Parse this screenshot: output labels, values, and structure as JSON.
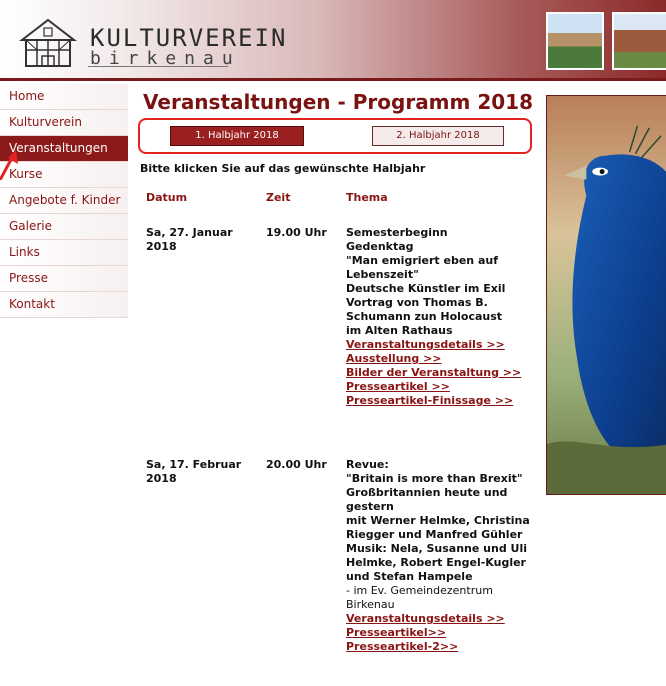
{
  "header": {
    "logo_title": "KULTURVEREIN",
    "logo_sub": "birkenau"
  },
  "sidebar": {
    "items": [
      {
        "label": "Home"
      },
      {
        "label": "Kulturverein"
      },
      {
        "label": "Veranstaltungen"
      },
      {
        "label": "Kurse"
      },
      {
        "label": "Angebote f. Kinder"
      },
      {
        "label": "Galerie"
      },
      {
        "label": "Links"
      },
      {
        "label": "Presse"
      },
      {
        "label": "Kontakt"
      }
    ],
    "active_index": 2
  },
  "main": {
    "title": "Veranstaltungen - Programm 2018",
    "tabs": [
      {
        "label": "1. Halbjahr 2018"
      },
      {
        "label": "2. Halbjahr 2018"
      }
    ],
    "hint": "Bitte klicken Sie auf das gewünschte Halbjahr",
    "columns": {
      "date": "Datum",
      "time": "Zeit",
      "topic": "Thema"
    },
    "events": [
      {
        "date_line1": "Sa, 27. Januar",
        "date_line2": "2018",
        "time": "19.00 Uhr",
        "topic_lines": [
          "Semesterbeginn",
          "Gedenktag",
          "\"Man emigriert eben auf",
          "Lebenszeit\"",
          "Deutsche Künstler im Exil",
          "Vortrag von Thomas B.",
          "Schumann zun Holocaust",
          "im Alten Rathaus"
        ],
        "links": [
          "Veranstaltungsdetails >>",
          "Ausstellung >>",
          "Bilder der Veranstaltung >>",
          "Presseartikel >>",
          "Presseartikel-Finissage >>"
        ]
      },
      {
        "date_line1": "Sa, 17. Februar",
        "date_line2": "2018",
        "time": "20.00 Uhr",
        "topic_lines": [
          "Revue:",
          "\"Britain is more than Brexit\"",
          "Großbritannien heute und",
          "gestern",
          "mit Werner Helmke, Christina",
          "Riegger und Manfred Gühler",
          "Musik: Nela, Susanne und Uli",
          "Helmke, Robert Engel-Kugler",
          "und Stefan Hampele"
        ],
        "plain_lines": [
          "- im Ev. Gemeindezentrum",
          "Birkenau"
        ],
        "links": [
          "Veranstaltungsdetails >>",
          "Presseartikel>>",
          "Presseartikel-2>>"
        ]
      }
    ]
  },
  "colors": {
    "brand_red": "#8c1a1a",
    "link_red": "#8a1414",
    "highlight_box": "#e52222"
  },
  "icons": {
    "logo": "half-timbered-house-icon",
    "annotation": "red-arrow-icon"
  }
}
